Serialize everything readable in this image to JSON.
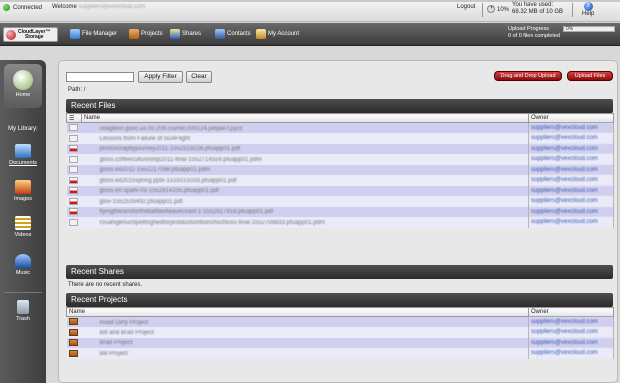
{
  "topbar": {
    "status": "Connected",
    "welcome_label": "Welcome",
    "welcome_user": "suppliers@vexcloud.com",
    "logout": "Logout",
    "usage_percent": "10%",
    "used_label": "You have used:",
    "used_value": "68.32 MB of 10 GB",
    "help": "Help"
  },
  "navbar": {
    "logo_line1": "CloudLayer™",
    "logo_line2": "Storage",
    "items": [
      "File Manager",
      "Projects",
      "Shares",
      "Contacts",
      "My Account"
    ],
    "upload_progress_label": "Upload Progress",
    "upload_progress_value": "0%",
    "upload_status": "0 of 0 files completed"
  },
  "sidebar": {
    "home": "Home",
    "library_title": "My Library:",
    "items": [
      "Documents",
      "Images",
      "Videos",
      "Music"
    ],
    "trash": "Trash"
  },
  "toolbar": {
    "filter_placeholder": "",
    "apply_filter": "Apply Filter",
    "clear": "Clear",
    "drag_drop": "Drag and Drop Upload",
    "upload_files": "Upload Files",
    "path_label": "Path:",
    "path_value": "/"
  },
  "recent_files": {
    "title": "Recent Files",
    "columns": [
      "Name",
      "Owner"
    ],
    "rows": [
      {
        "name": "ceagleon.gsoc.us.00.209.csvnet.000124.piepaf-f.pyzz",
        "owner": "suppliers@vexcloud.com",
        "icon": "doc"
      },
      {
        "name": "Lessons from Failure of 5G4Flight",
        "owner": "suppliers@vexcloud.com",
        "icon": "doc"
      },
      {
        "name": "photoscrapbyjourney2011-1552519226.pfuapp01.pdf",
        "owner": "suppliers@vexcloud.com",
        "icon": "pdf"
      },
      {
        "name": "gloss.coffeecultureship2011-final-1552714559.pfuapp01.pdm",
        "owner": "suppliers@vexcloud.com",
        "icon": "doc"
      },
      {
        "name": "gloss.ed2011-1552217098.pfuapp01.pdm",
        "owner": "suppliers@vexcloud.com",
        "icon": "doc"
      },
      {
        "name": "gloss.ed2015spring.pptx-1519151033.pfuapp01.pdf",
        "owner": "suppliers@vexcloud.com",
        "icon": "pdf"
      },
      {
        "name": "gloss.en.spark-03-1552814105.pfuapp01.pdf",
        "owner": "suppliers@vexcloud.com",
        "icon": "pdf"
      },
      {
        "name": "glov-1552516492.pfuapp01.pdf",
        "owner": "suppliers@vexcloud.com",
        "icon": "pdf"
      },
      {
        "name": "flyingthesinsforthebattleofwavecoast-1-1552617916.pfuapp01.pdf",
        "owner": "suppliers@vexcloud.com",
        "icon": "pdf"
      },
      {
        "name": "rosahigenuchpelfinghedtorprotdustumbunchschloss-final-1552708833.pfuapp01.pdm",
        "owner": "suppliers@vexcloud.com",
        "icon": "doc"
      }
    ]
  },
  "recent_shares": {
    "title": "Recent Shares",
    "empty": "There are no recent shares."
  },
  "recent_projects": {
    "title": "Recent Projects",
    "columns": [
      "Name",
      "Owner"
    ],
    "rows": [
      {
        "name": "Road Dirty Project",
        "owner": "suppliers@vexcloud.com"
      },
      {
        "name": "Bill and Brad Project",
        "owner": "suppliers@vexcloud.com"
      },
      {
        "name": "Brad Project",
        "owner": "suppliers@vexcloud.com"
      },
      {
        "name": "Bill Project",
        "owner": "suppliers@vexcloud.com"
      }
    ]
  },
  "colors": {
    "accent_red": "#b01010",
    "row_alt": "#cfcfef",
    "header_dark": "#2b2b2b"
  }
}
